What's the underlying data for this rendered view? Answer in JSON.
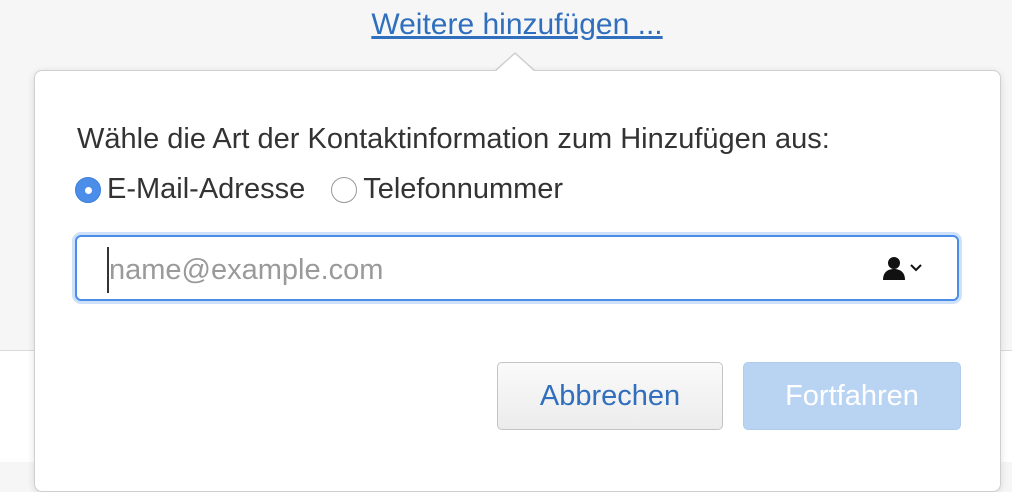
{
  "header": {
    "add_more_link": "Weitere hinzufügen ..."
  },
  "dialog": {
    "prompt": "Wähle die Art der Kontaktinformation zum Hinzufügen aus:",
    "options": [
      {
        "label": "E-Mail-Adresse",
        "selected": true
      },
      {
        "label": "Telefonnummer",
        "selected": false
      }
    ],
    "input": {
      "value": "",
      "placeholder": "name@example.com"
    },
    "contact_icon": "person-icon",
    "buttons": {
      "cancel": "Abbrechen",
      "continue": "Fortfahren"
    }
  },
  "colors": {
    "link": "#2f6fbd",
    "accent": "#4a8ee9",
    "disabled_button": "#b9d4f3"
  }
}
